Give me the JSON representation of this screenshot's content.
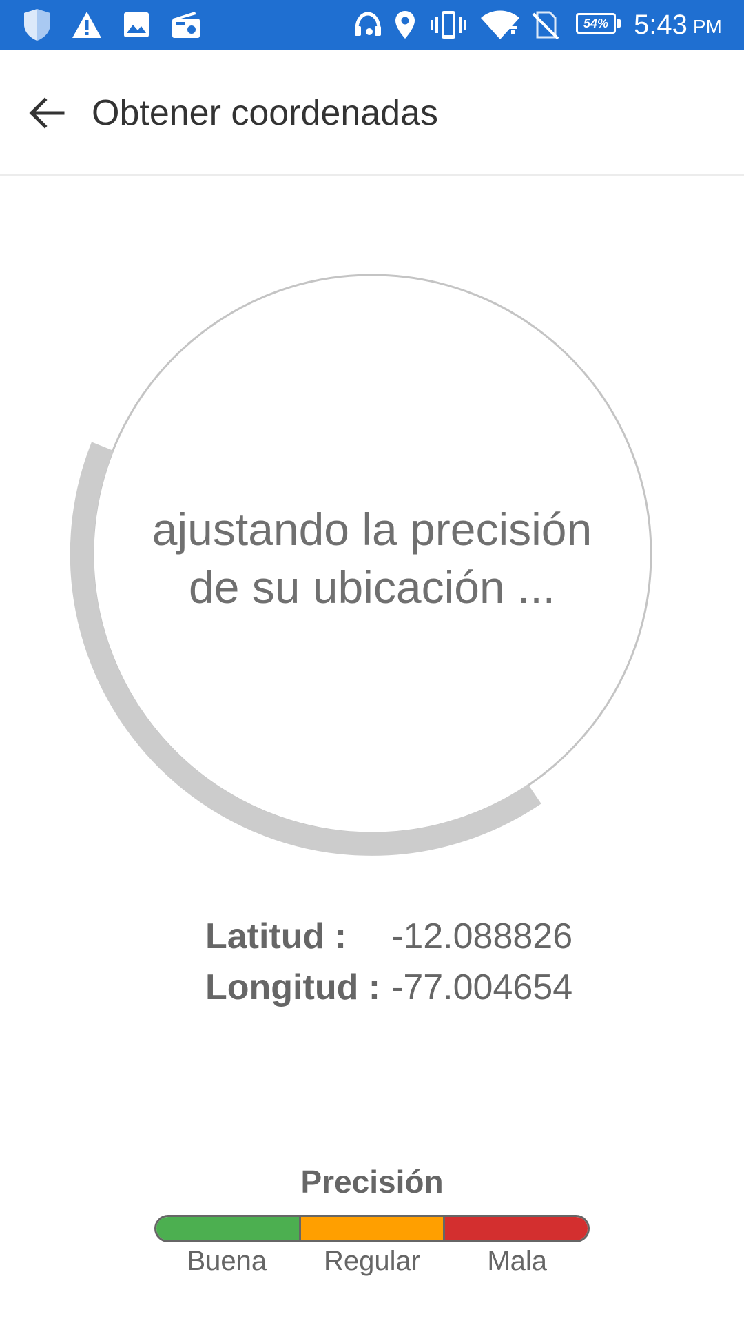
{
  "status_bar": {
    "time": "5:43",
    "ampm": "PM",
    "battery_percent": "54%",
    "icons": [
      "shield-icon",
      "warning-icon",
      "image-icon",
      "radio-icon",
      "headset-icon",
      "location-icon",
      "vibrate-icon",
      "wifi-icon",
      "no-sim-icon",
      "battery-icon"
    ]
  },
  "app_bar": {
    "title": "Obtener coordenadas",
    "back_icon": "arrow-back-icon"
  },
  "progress": {
    "message_line1": "ajustando la precisión",
    "message_line2": "de su ubicación ...",
    "arc_color": "#cccccc",
    "ring_color": "#c4c4c4"
  },
  "coordinates": {
    "latitude_label": "Latitud :",
    "latitude_value": "-12.088826",
    "longitude_label": "Longitud :",
    "longitude_value": "-77.004654"
  },
  "precision": {
    "title": "Precisión",
    "levels": [
      {
        "label": "Buena",
        "color": "#4caf50"
      },
      {
        "label": "Regular",
        "color": "#ff9f00"
      },
      {
        "label": "Mala",
        "color": "#d32f2f"
      }
    ]
  },
  "colors": {
    "status_bar": "#1f6fd1",
    "text_dark": "#333333",
    "text_gray": "#666666"
  }
}
